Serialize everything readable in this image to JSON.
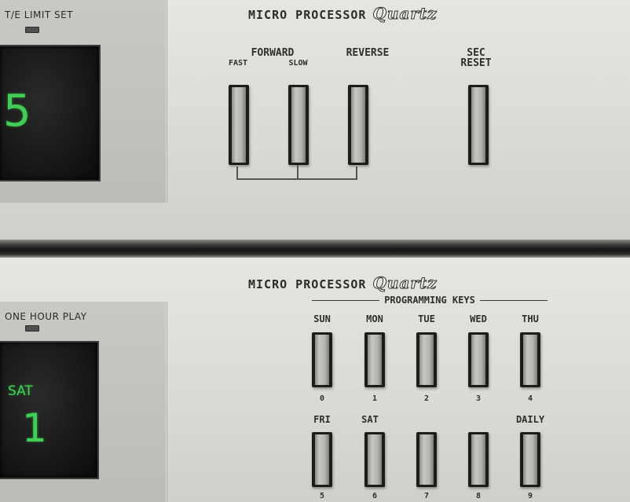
{
  "top_unit": {
    "panel_label": "T/E LIMIT SET",
    "display_digit": "5",
    "brand_text": "MICRO PROCESSOR",
    "brand_logo": "Quartz",
    "labels": {
      "forward": "FORWARD",
      "fast": "FAST",
      "slow": "SLOW",
      "reverse": "REVERSE",
      "sec": "SEC",
      "reset": "RESET"
    }
  },
  "bottom_unit": {
    "panel_label": "ONE HOUR PLAY",
    "display_day": "SAT",
    "display_digit": "1",
    "brand_text": "MICRO PROCESSOR",
    "brand_logo": "Quartz",
    "programming_title": "PROGRAMMING KEYS",
    "row1": {
      "days": [
        "SUN",
        "MON",
        "TUE",
        "WED",
        "THU"
      ],
      "numbers": [
        "0",
        "1",
        "2",
        "3",
        "4"
      ]
    },
    "row2": {
      "days": [
        "FRI",
        "SAT",
        "",
        "",
        "DAILY"
      ],
      "numbers": [
        "5",
        "6",
        "7",
        "8",
        "9"
      ]
    }
  },
  "colors": {
    "panel": "#dadad4",
    "display_green": "#3fcf55",
    "key_frame": "#1c1c1c"
  }
}
